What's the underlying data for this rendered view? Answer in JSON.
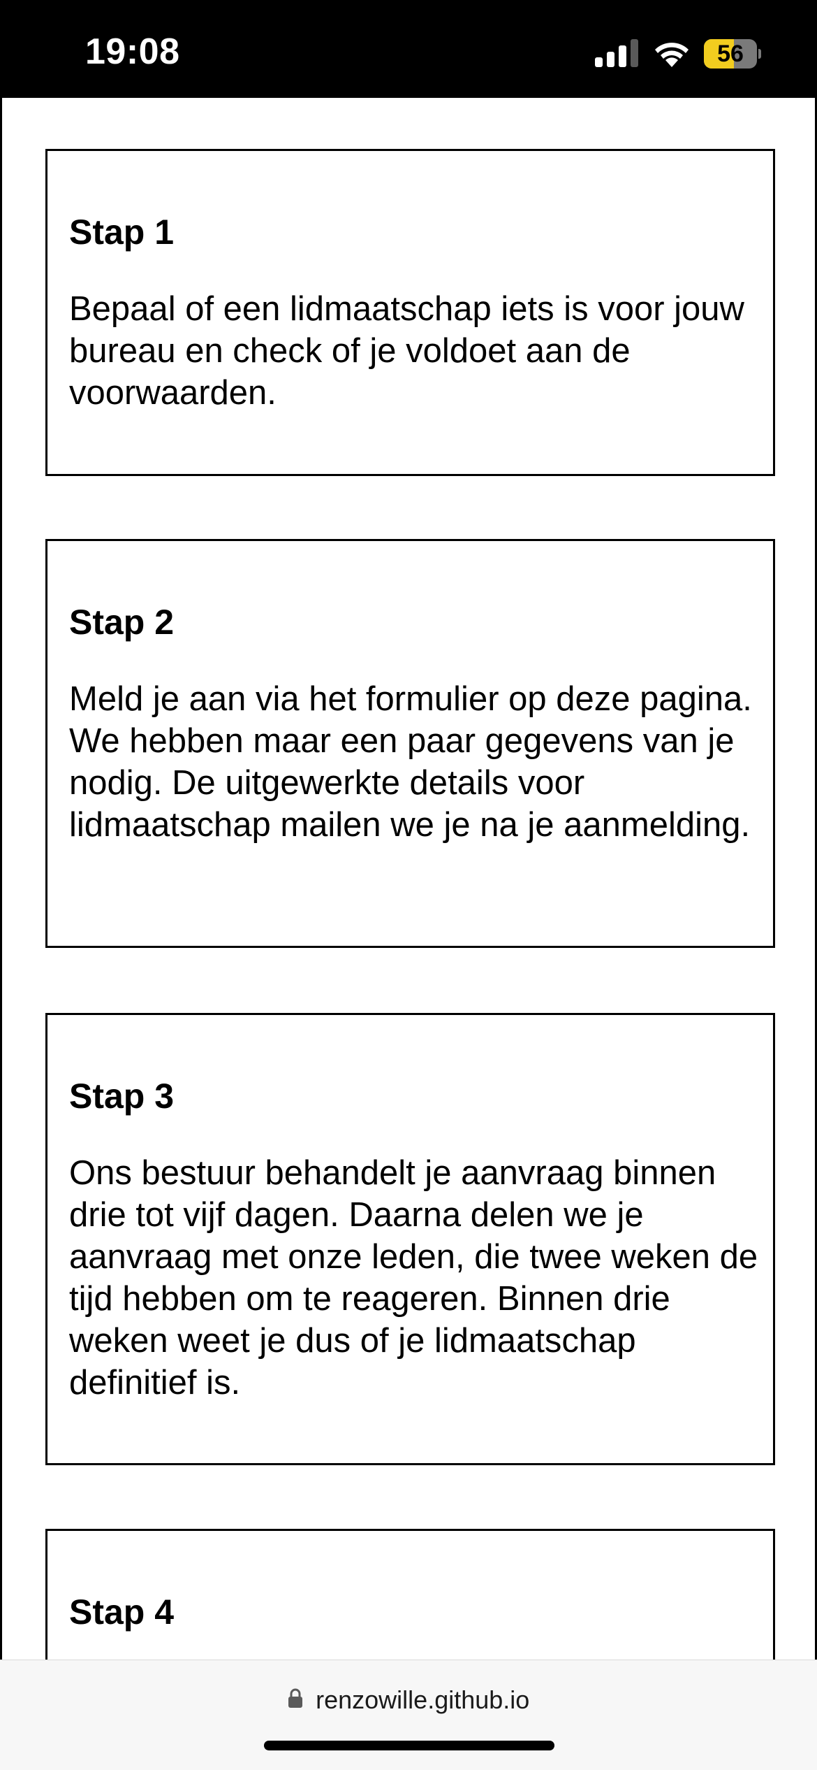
{
  "status_bar": {
    "time": "19:08",
    "battery_level": "56",
    "battery_fraction": 0.56,
    "signal_bars_active": 3,
    "signal_bars_total": 4,
    "icons": [
      "signal-icon",
      "wifi-icon",
      "battery-icon"
    ]
  },
  "steps": [
    {
      "title": "Stap 1",
      "text": "Bepaal of een lidmaatschap iets is voor jouw bureau en check of je voldoet aan de voorwaarden."
    },
    {
      "title": "Stap 2",
      "text": "Meld je aan via het formulier op deze pagina. We hebben maar een paar gegevens van je nodig. De uitgewerkte details voor lidmaatschap mailen we je na je aanmelding."
    },
    {
      "title": "Stap 3",
      "text": "Ons bestuur behandelt je aanvraag binnen drie tot vijf dagen. Daarna delen we je aanvraag met onze leden, die twee weken de tijd hebben om te reageren. Binnen drie weken weet je dus of je lidmaatschap definitief is."
    },
    {
      "title": "Stap 4",
      "text": ""
    }
  ],
  "browser": {
    "url": "renzowille.github.io",
    "lock_icon": "lock-icon"
  },
  "colors": {
    "status_bar_bg": "#000000",
    "battery_fill": "#f2cd1f",
    "battery_empty": "#7a7a7a",
    "browser_bar_bg": "#f7f7f7"
  }
}
